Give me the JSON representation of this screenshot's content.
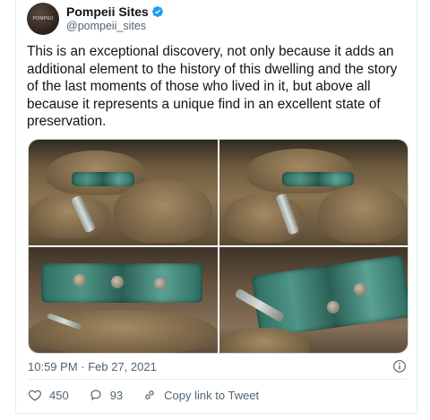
{
  "account": {
    "avatar_text": "POMPEII",
    "name": "Pompeii Sites",
    "handle": "@pompeii_sites"
  },
  "tweet": {
    "text": "This is an exceptional discovery, not only because it adds an additional element to the history of this dwelling and the story of the last moments of those who lived in it, but above all because it represents a unique find in an excellent state of preservation."
  },
  "meta": {
    "timestamp": "10:59 PM · Feb 27, 2021"
  },
  "actions": {
    "likes": "450",
    "replies": "93",
    "copy_link": "Copy link to Tweet"
  },
  "colors": {
    "verified": "#1d9bf0",
    "secondary_text": "#536471",
    "patina": "#4f9687"
  },
  "icons": [
    "verified-badge-icon",
    "info-icon",
    "heart-icon",
    "reply-icon",
    "link-icon"
  ]
}
